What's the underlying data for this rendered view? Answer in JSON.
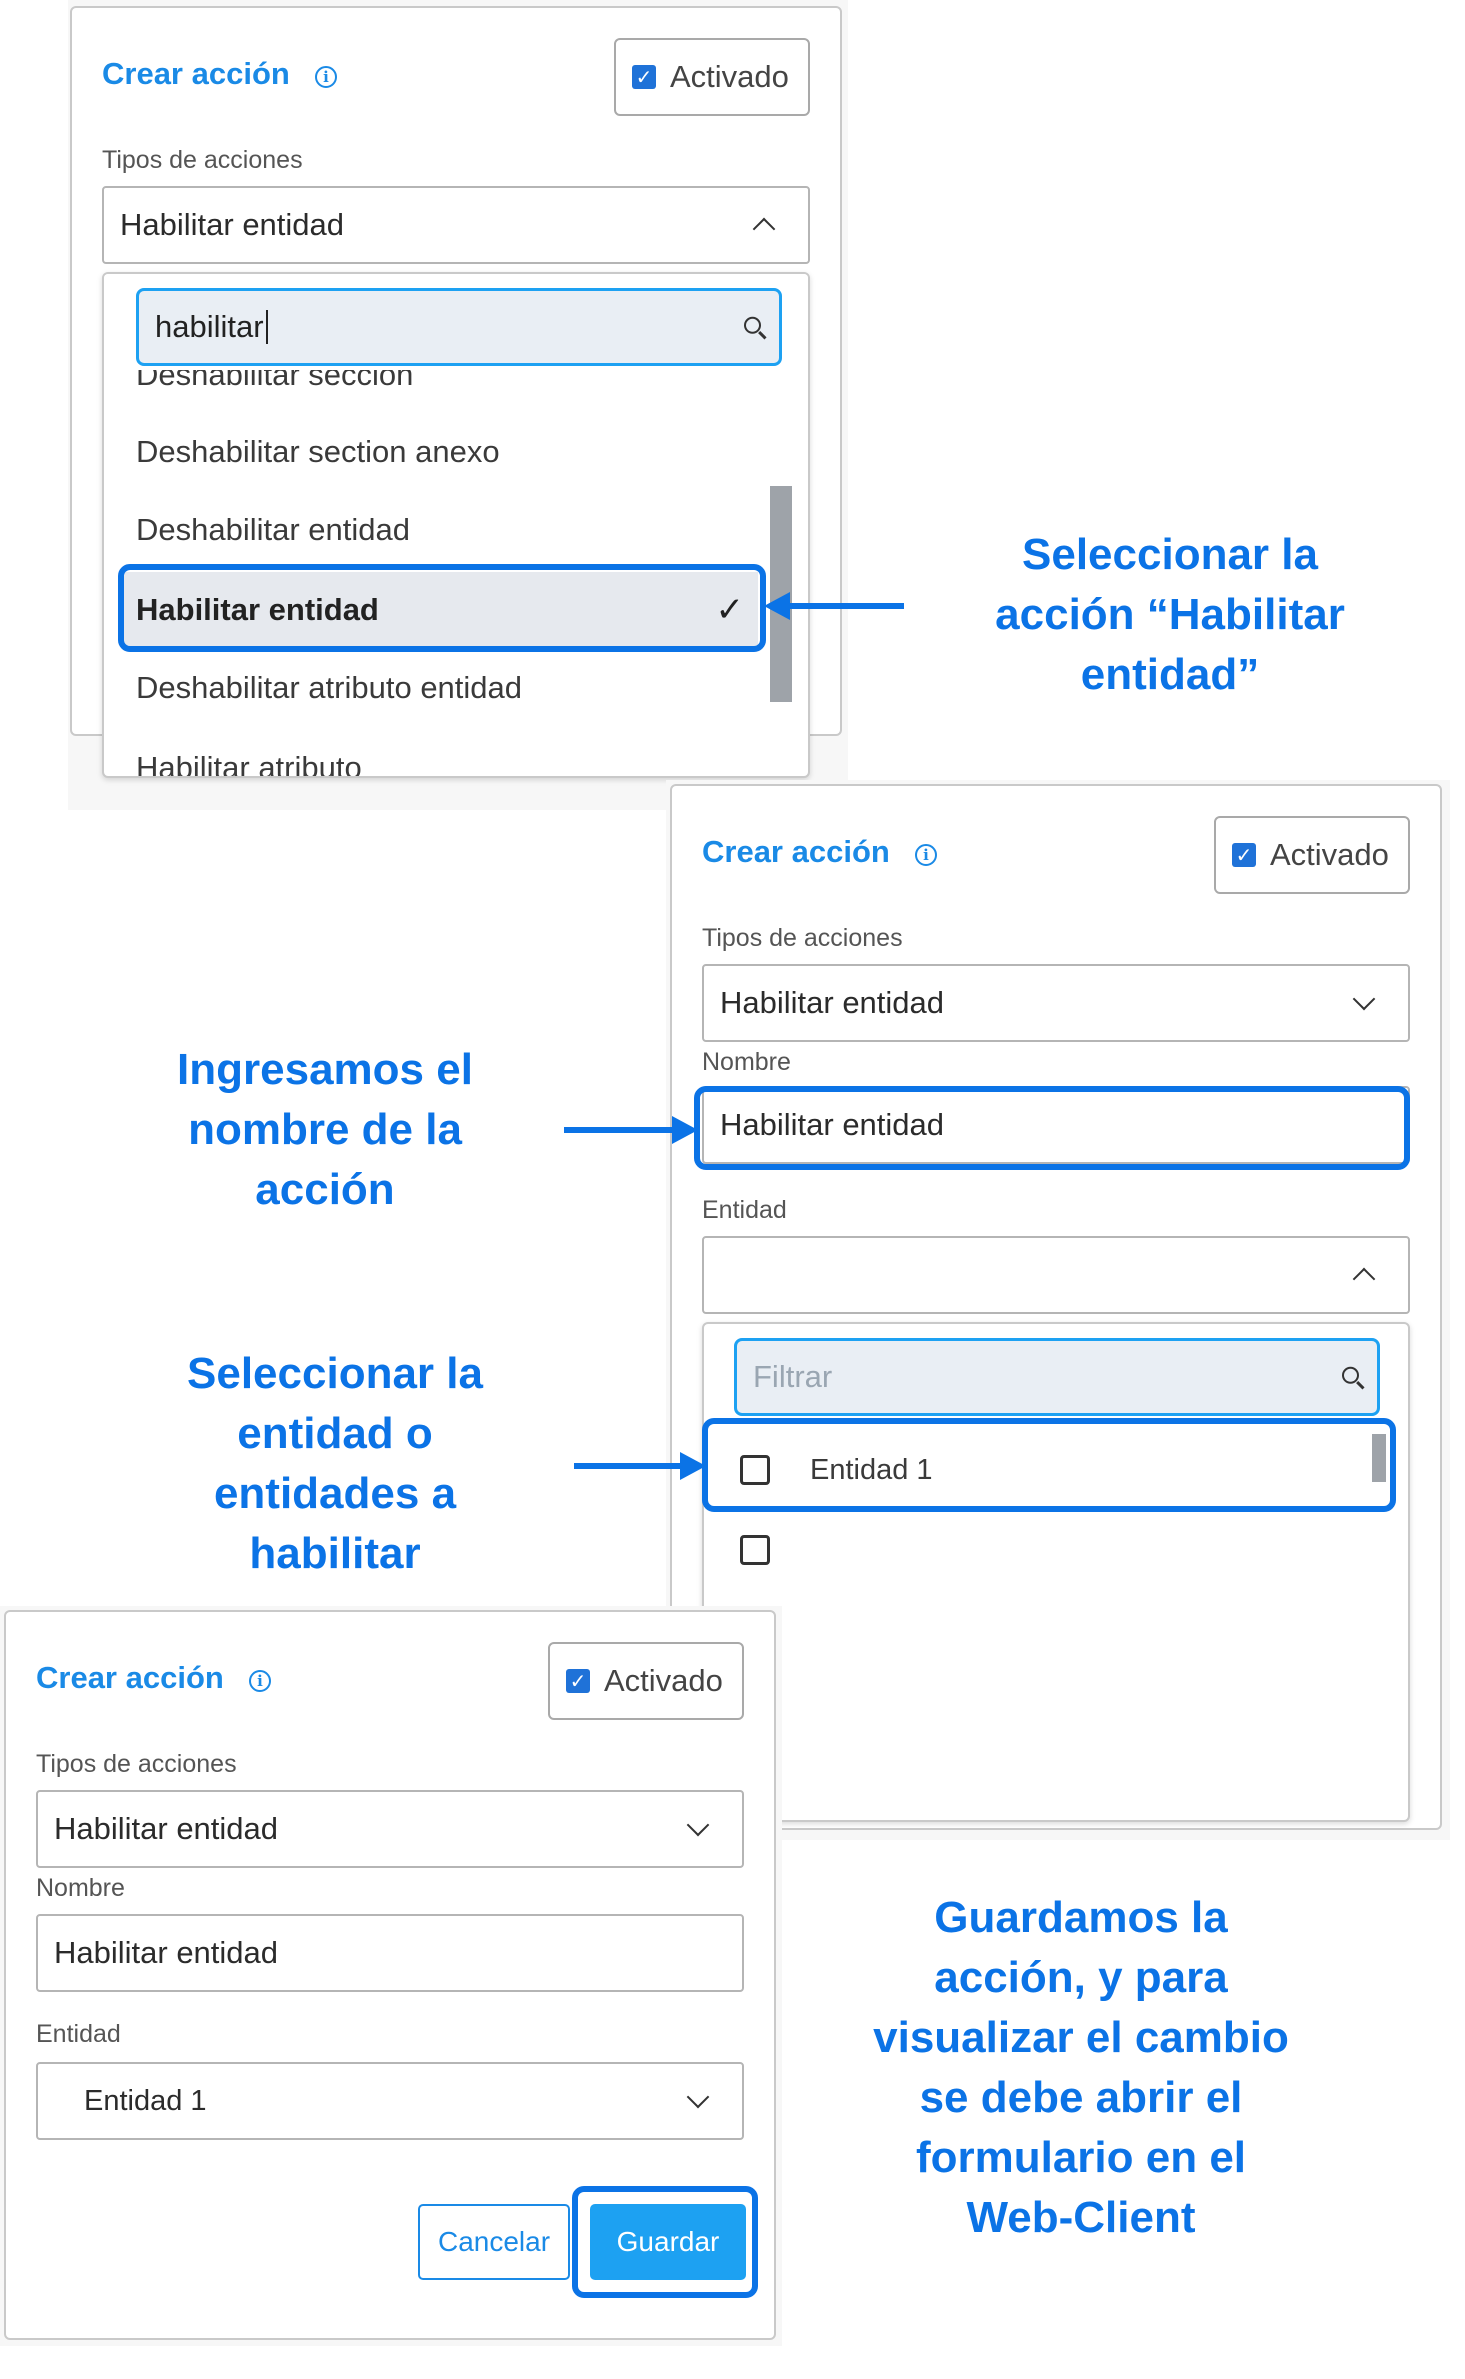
{
  "form": {
    "title": "Crear acción",
    "activated_label": "Activado",
    "action_types_label": "Tipos de acciones",
    "action_type_value": "Habilitar entidad",
    "name_label": "Nombre",
    "name_value": "Habilitar entidad",
    "entity_label": "Entidad",
    "entity_value": "Entidad 1",
    "cancel_label": "Cancelar",
    "save_label": "Guardar"
  },
  "step1": {
    "search_value": "habilitar",
    "options": [
      "Deshabilitar sección",
      "Deshabilitar section anexo",
      "Deshabilitar entidad",
      "Habilitar entidad",
      "Deshabilitar atributo entidad",
      "Habilitar atributo"
    ],
    "selected_index": 3
  },
  "step2": {
    "filter_placeholder": "Filtrar",
    "entity_options": [
      "Entidad 1",
      ""
    ]
  },
  "callouts": {
    "select_action": "Seleccionar la acción “Habilitar entidad”",
    "enter_name": "Ingresamos el nombre de la acción",
    "select_entity": "Seleccionar la entidad o entidades a habilitar",
    "save": "Guardamos la acción, y para visualizar el cambio se debe abrir el formulario en el Web-Client"
  },
  "colors": {
    "accent": "#1a8ae6",
    "highlight": "#0b73e6",
    "save_button": "#1da1f2"
  }
}
